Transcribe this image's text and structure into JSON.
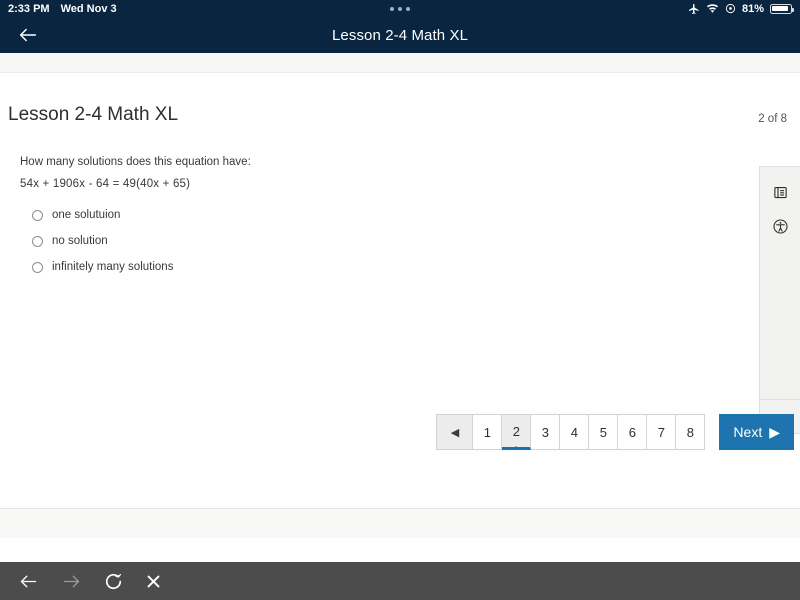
{
  "status_bar": {
    "time": "2:33 PM",
    "date": "Wed Nov 3",
    "battery_percent": "81%",
    "icons": [
      "airplane-mode-icon",
      "wifi-icon",
      "orientation-lock-icon",
      "battery-icon"
    ],
    "center_indicator": "three-dots-indicator",
    "background_color": "#09253f"
  },
  "nav_bar": {
    "back_label": "back-arrow",
    "title": "Lesson 2-4 Math XL"
  },
  "content": {
    "page_title": "Lesson 2-4 Math XL",
    "page_count": "2 of 8",
    "question": "How many solutions does this equation have:",
    "equation": "54x  + 1906x  - 64 = 49(40x  + 65)",
    "choices": [
      {
        "label": "one solutuion",
        "selected": false
      },
      {
        "label": "no solution",
        "selected": false
      },
      {
        "label": "infinitely many solutions",
        "selected": false
      }
    ]
  },
  "tool_rail": {
    "buttons": [
      "outline-list-icon",
      "accessibility-icon"
    ],
    "collapse_label": "‹"
  },
  "pagination": {
    "prev_label": "◀",
    "pages": [
      "1",
      "2",
      "3",
      "4",
      "5",
      "6",
      "7",
      "8"
    ],
    "active_page": "2",
    "next_label": "Next",
    "next_arrow": "▶",
    "accent_color": "#1e74ae"
  },
  "browser_toolbar": {
    "buttons": [
      {
        "name": "back-icon",
        "enabled": true
      },
      {
        "name": "forward-icon",
        "enabled": false
      },
      {
        "name": "reload-icon",
        "enabled": true
      },
      {
        "name": "close-icon",
        "enabled": true
      }
    ],
    "background_color": "#4c4c4c"
  }
}
